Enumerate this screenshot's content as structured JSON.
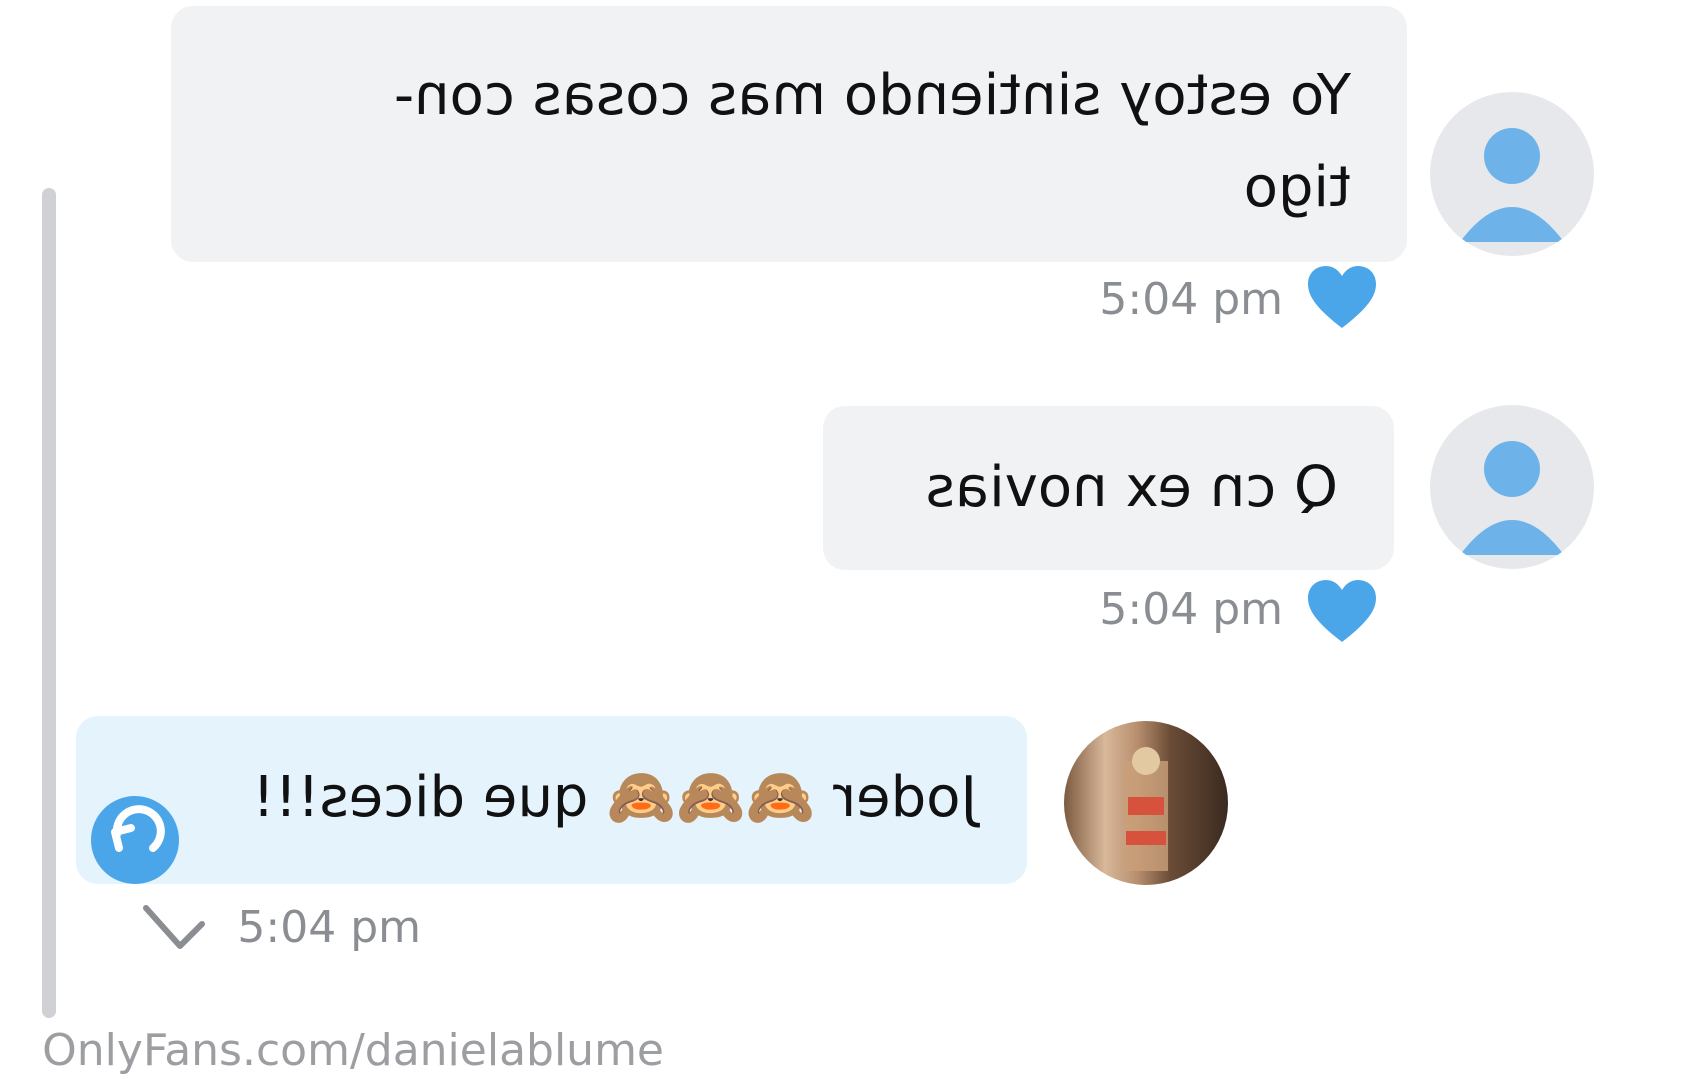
{
  "messages": [
    {
      "text": "Yo estoy sintiendo mas cosas con-\ntigo",
      "time": "5:04 pm",
      "liked": true
    },
    {
      "text": "Q cn ex novias",
      "time": "5:04 pm",
      "liked": true
    },
    {
      "text": "Joder 🙈🙈🙈 que dices!!!",
      "time": "5:04 pm",
      "liked": false
    }
  ],
  "watermark": "OnlyFans.com/danielablume",
  "colors": {
    "incoming_bubble": "#f1f2f4",
    "outgoing_bubble": "#e4f3fc",
    "accent_blue": "#4aa6e8",
    "timestamp": "#8a8d91"
  },
  "icons": {
    "like": "heart-icon",
    "avatar_placeholder": "default-user-icon",
    "reply": "reply-arrow-icon",
    "status": "check-icon"
  }
}
